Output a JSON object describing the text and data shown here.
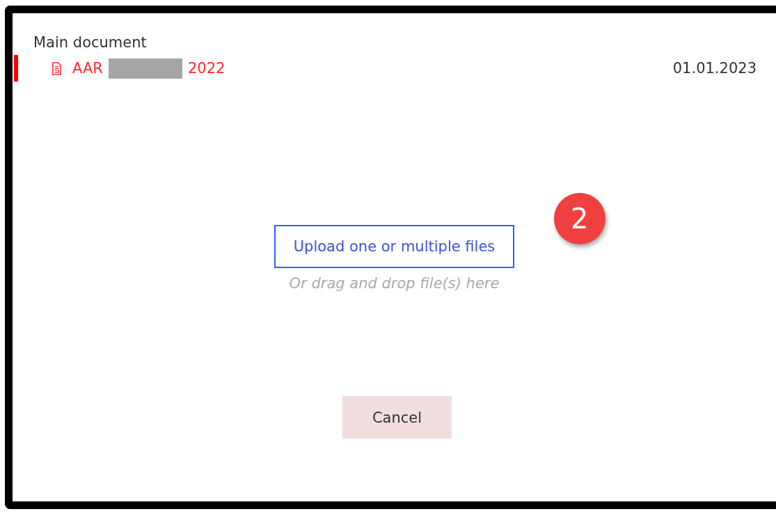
{
  "section_title": "Main document",
  "document": {
    "name_start": "AAR",
    "redacted": true,
    "name_end": "2022",
    "date": "01.01.2023",
    "selected": true
  },
  "upload": {
    "button": "Upload one or multiple files",
    "hint": "Or drag and drop file(s) here"
  },
  "callout": {
    "label": "2"
  },
  "buttons": [
    {
      "label": "Cancel",
      "kind": "cancel"
    }
  ]
}
